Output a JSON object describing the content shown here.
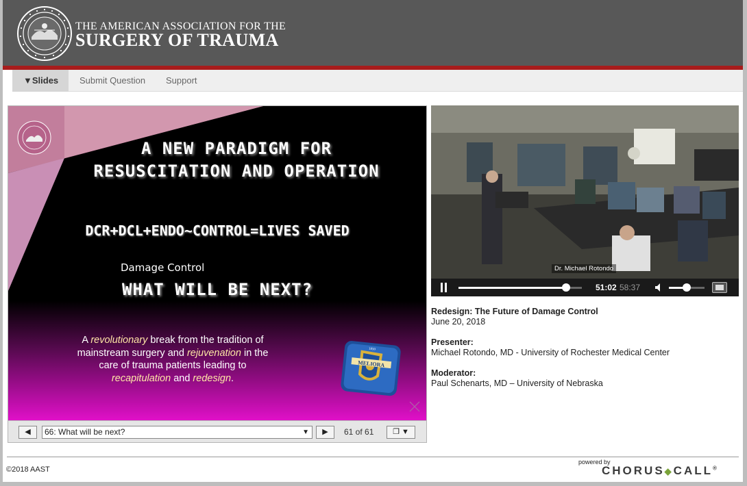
{
  "header": {
    "org_line1": "THE AMERICAN ASSOCIATION FOR THE",
    "org_line2": "SURGERY OF TRAUMA"
  },
  "nav": {
    "slides": "▼Slides",
    "submit_question": "Submit Question",
    "support": "Support"
  },
  "slide": {
    "title_line1": "A NEW PARADIGM FOR",
    "title_line2": "RESUSCITATION AND OPERATION",
    "formula": "DCR+DCL+ENDO~CONTROL=LIVES SAVED",
    "subheading": "Damage Control",
    "question": "WHAT WILL BE NEXT?",
    "body": {
      "p1": "A ",
      "h1": "revolutionary",
      "p2": " break from the tradition of mainstream surgery and ",
      "h2": "rejuvenation",
      "p3": " in the care of trauma patients leading to ",
      "h3": "recapitulation",
      "p4": " and ",
      "h4": "redesign",
      "p5": "."
    },
    "badge_text": "MELIORA",
    "badge_year": "1850"
  },
  "slide_controls": {
    "prev": "◀",
    "next": "▶",
    "selected": "66: What will be next?",
    "count": "61 of 61",
    "view": "❐ ▼"
  },
  "video": {
    "speaker_label": "Dr. Michael Rotondo",
    "current_time": "51:02",
    "duration": "58:37",
    "progress": 0.87,
    "volume": 0.5
  },
  "info": {
    "title": "Redesign: The Future of Damage Control",
    "date": "June 20, 2018",
    "presenter_label": "Presenter:",
    "presenter": "Michael Rotondo, MD - University of Rochester Medical Center",
    "moderator_label": "Moderator:",
    "moderator": "Paul Schenarts, MD – University of Nebraska"
  },
  "footer": {
    "copyright": "©2018 AAST",
    "powered_by": "powered by",
    "brand_left": "CHORUS",
    "brand_right": "CALL",
    "brand_mark": "®"
  },
  "colors": {
    "header_bg": "#585858",
    "accent_red": "#a81c1c",
    "slide_magenta": "#e010c8",
    "brand_green": "#7aa339"
  },
  "icons": [
    "aast-seal-icon",
    "play-pause-icon",
    "volume-icon",
    "fullscreen-icon",
    "resize-icon"
  ]
}
